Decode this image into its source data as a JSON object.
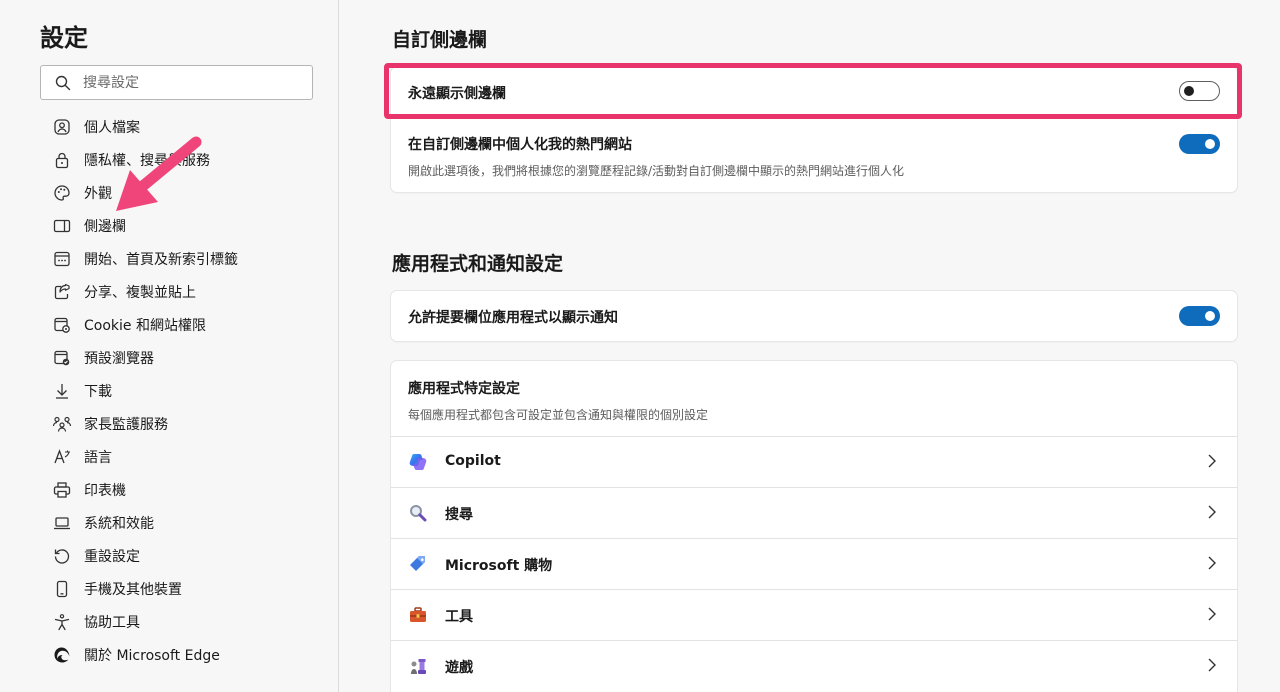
{
  "sidebar": {
    "title": "設定",
    "search_placeholder": "搜尋設定",
    "items": [
      {
        "label": "個人檔案",
        "icon": "profile-icon"
      },
      {
        "label": "隱私權、搜尋與服務",
        "icon": "lock-icon"
      },
      {
        "label": "外觀",
        "icon": "palette-icon"
      },
      {
        "label": "側邊欄",
        "icon": "sidebar-icon"
      },
      {
        "label": "開始、首頁及新索引標籤",
        "icon": "new-tab-icon"
      },
      {
        "label": "分享、複製並貼上",
        "icon": "share-icon"
      },
      {
        "label": "Cookie 和網站權限",
        "icon": "site-permissions-icon"
      },
      {
        "label": "預設瀏覽器",
        "icon": "default-browser-icon"
      },
      {
        "label": "下載",
        "icon": "download-icon"
      },
      {
        "label": "家長監護服務",
        "icon": "family-icon"
      },
      {
        "label": "語言",
        "icon": "language-icon"
      },
      {
        "label": "印表機",
        "icon": "printer-icon"
      },
      {
        "label": "系統和效能",
        "icon": "laptop-icon"
      },
      {
        "label": "重設設定",
        "icon": "reset-icon"
      },
      {
        "label": "手機及其他裝置",
        "icon": "phone-icon"
      },
      {
        "label": "協助工具",
        "icon": "accessibility-icon"
      },
      {
        "label": "關於 Microsoft Edge",
        "icon": "edge-logo-icon"
      }
    ]
  },
  "main": {
    "section1": {
      "title": "自訂側邊欄",
      "always_show": {
        "label": "永遠顯示側邊欄",
        "enabled": false
      },
      "personalize": {
        "label": "在自訂側邊欄中個人化我的熱門網站",
        "description": "開啟此選項後，我們將根據您的瀏覽歷程記錄/活動對自訂側邊欄中顯示的熱門網站進行個人化",
        "enabled": true
      }
    },
    "section2": {
      "title": "應用程式和通知設定",
      "allow_notifications": {
        "label": "允許提要欄位應用程式以顯示通知",
        "enabled": true
      },
      "app_specific": {
        "title": "應用程式特定設定",
        "description": "每個應用程式都包含可設定並包含通知與權限的個別設定",
        "apps": [
          {
            "label": "Copilot",
            "icon": "copilot-icon"
          },
          {
            "label": "搜尋",
            "icon": "search-app-icon"
          },
          {
            "label": "Microsoft 購物",
            "icon": "shopping-tag-icon"
          },
          {
            "label": "工具",
            "icon": "toolbox-icon"
          },
          {
            "label": "遊戲",
            "icon": "chess-icon"
          }
        ]
      }
    }
  },
  "colors": {
    "toggle_on": "#0f6cbd",
    "highlight": "#e8336b",
    "annotation_arrow": "#f0457a"
  }
}
